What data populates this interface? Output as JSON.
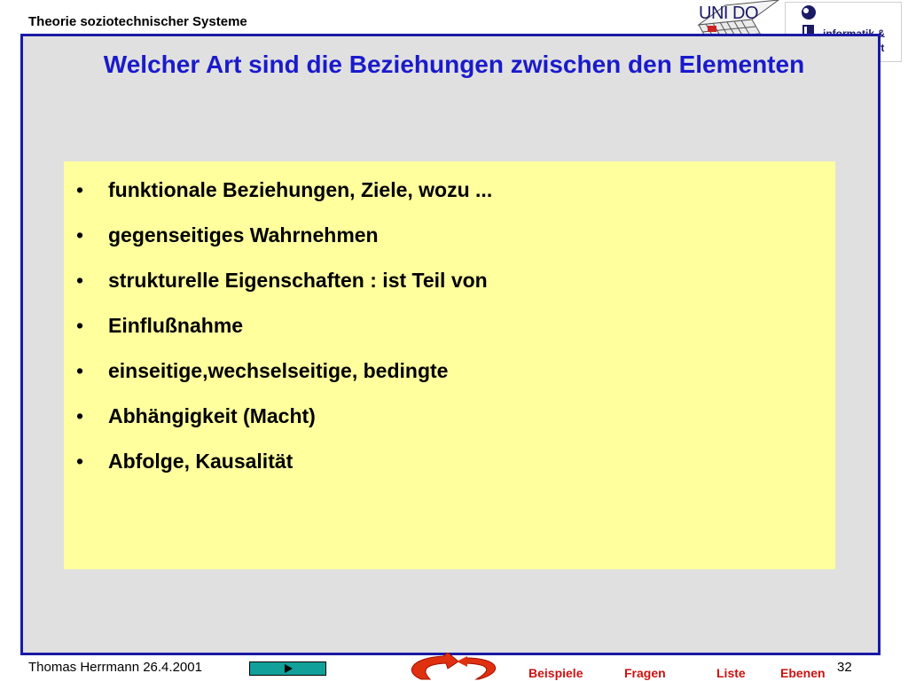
{
  "header": {
    "title": "Theorie soziotechnischer Systeme"
  },
  "logos": {
    "unido": {
      "text": "UNI DO",
      "icon": "unido-grid-logo-icon"
    },
    "ig": {
      "line1": "informatik &",
      "line2": "gesellschaft",
      "icon": "info-i-icon"
    }
  },
  "slide": {
    "title": "Welcher Art sind die Beziehungen zwischen den Elementen",
    "bullet_char": "•",
    "bullets": [
      "funktionale Beziehungen, Ziele, wozu ...",
      "gegenseitiges Wahrnehmen",
      "strukturelle Eigenschaften : ist Teil von",
      "Einflußnahme",
      "einseitige,wechselseitige, bedingte",
      "Abhängigkeit (Macht)",
      "Abfolge, Kausalität"
    ]
  },
  "footer": {
    "author": "Thomas Herrmann 26.4.2001",
    "page": "32",
    "play_icon": "play-arrow-icon",
    "swirl_icon": "swirl-arrow-icon",
    "nav": [
      "Beispiele",
      "Fragen",
      "Liste",
      "Ebenen"
    ]
  },
  "colors": {
    "frame_border": "#1a1aa6",
    "title": "#1a1acc",
    "content_bg": "#ffff9e",
    "nav_link": "#cc1111",
    "play_button": "#12a09a"
  }
}
